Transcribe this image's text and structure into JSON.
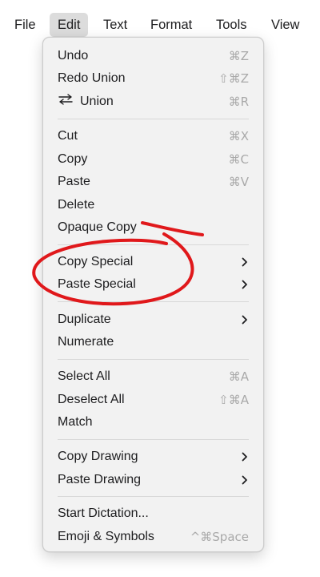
{
  "menubar": {
    "items": [
      "File",
      "Edit",
      "Text",
      "Format",
      "Tools",
      "View"
    ]
  },
  "menu": {
    "items": [
      {
        "label": "Undo",
        "shortcut": "⌘Z"
      },
      {
        "label": "Redo Union",
        "shortcut": "⇧⌘Z"
      },
      {
        "label": "Union",
        "shortcut": "⌘R",
        "icon": "swap-arrows-icon"
      },
      {
        "label": "Cut",
        "shortcut": "⌘X"
      },
      {
        "label": "Copy",
        "shortcut": "⌘C"
      },
      {
        "label": "Paste",
        "shortcut": "⌘V"
      },
      {
        "label": "Delete"
      },
      {
        "label": "Opaque Copy"
      },
      {
        "label": "Copy Special",
        "submenu": true
      },
      {
        "label": "Paste Special",
        "submenu": true
      },
      {
        "label": "Duplicate",
        "submenu": true
      },
      {
        "label": "Numerate"
      },
      {
        "label": "Select All",
        "shortcut": "⌘A"
      },
      {
        "label": "Deselect All",
        "shortcut": "⇧⌘A"
      },
      {
        "label": "Match"
      },
      {
        "label": "Copy Drawing",
        "submenu": true
      },
      {
        "label": "Paste Drawing",
        "submenu": true
      },
      {
        "label": "Start Dictation..."
      },
      {
        "label": "Emoji & Symbols",
        "shortcut": "^⌘Space"
      }
    ]
  },
  "annotation": {
    "color": "#e0181b"
  }
}
